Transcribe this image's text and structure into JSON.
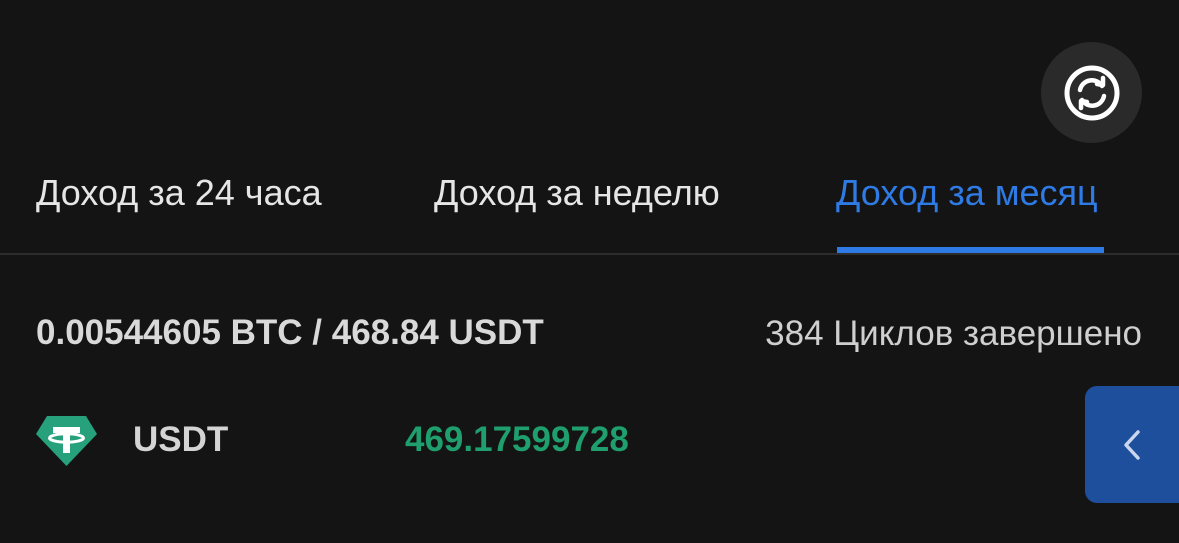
{
  "header": {
    "refresh_icon": "refresh-icon"
  },
  "tabs": [
    {
      "label": "Доход за 24 часа",
      "active": false
    },
    {
      "label": "Доход за неделю",
      "active": false
    },
    {
      "label": "Доход за месяц",
      "active": true
    }
  ],
  "summary": {
    "total": "0.00544605 BTC / 468.84 USDT",
    "cycles": "384 Циклов завершено"
  },
  "coins": [
    {
      "symbol": "USDT",
      "amount": "469.17599728",
      "icon": "tether-icon"
    }
  ],
  "side_tab": {
    "icon": "chevron-left-icon"
  },
  "colors": {
    "background": "#141414",
    "accent": "#2f7be6",
    "positive": "#1f9e6e",
    "tether": "#26a17b",
    "side_tab": "#1d4f9d"
  }
}
